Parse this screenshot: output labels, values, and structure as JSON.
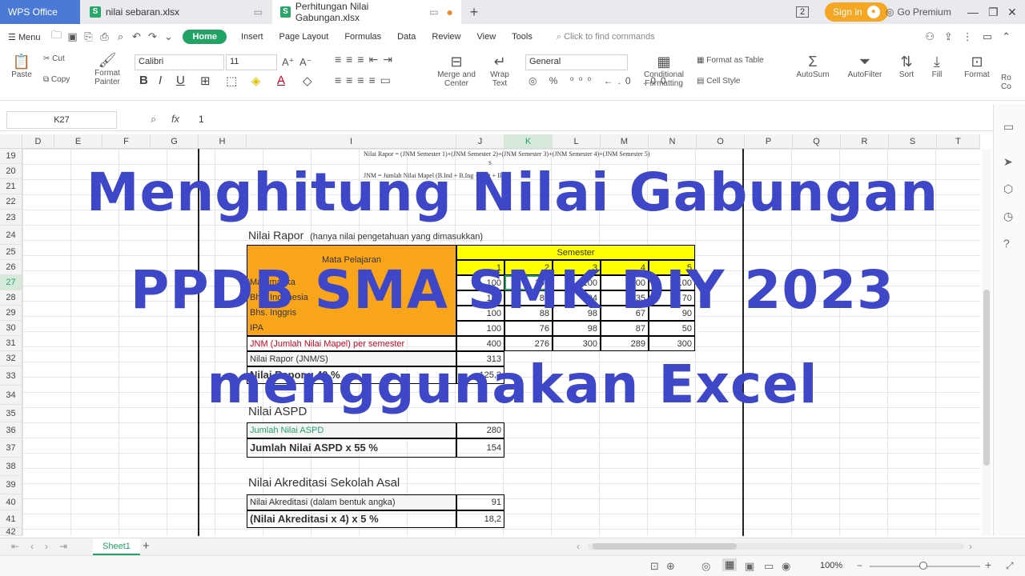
{
  "tabs": {
    "app": "WPS Office",
    "file1": "nilai sebaran.xlsx",
    "file2": "Perhitungan Nilai Gabungan.xlsx",
    "file_icon": "S"
  },
  "topbar": {
    "signin": "Sign in",
    "premium": "Go Premium",
    "badge": "2"
  },
  "menu": {
    "menu_label": "Menu",
    "items": [
      "Home",
      "Insert",
      "Page Layout",
      "Formulas",
      "Data",
      "Review",
      "View",
      "Tools"
    ],
    "search": "Click to find commands"
  },
  "ribbon": {
    "paste": "Paste",
    "cut": "Cut",
    "copy": "Copy",
    "format_painter_1": "Format",
    "format_painter_2": "Painter",
    "font_name": "Calibri",
    "font_size": "11",
    "merge_1": "Merge and",
    "merge_2": "Center",
    "wrap_1": "Wrap",
    "wrap_2": "Text",
    "number_format": "General",
    "cond_1": "Conditional",
    "cond_2": "Formatting",
    "format_table": "Format as Table",
    "cell_style": "Cell Style",
    "autosum": "AutoSum",
    "autofilter": "AutoFilter",
    "sort": "Sort",
    "fill": "Fill",
    "format": "Format",
    "rowcol": "Ro Co"
  },
  "formula_bar": {
    "cell_ref": "K27",
    "fx": "fx",
    "value": "1"
  },
  "columns": [
    "D",
    "E",
    "F",
    "G",
    "H",
    "I",
    "J",
    "K",
    "L",
    "M",
    "N",
    "O",
    "P",
    "Q",
    "R",
    "S",
    "T"
  ],
  "rows": [
    "19",
    "20",
    "21",
    "22",
    "23",
    "24",
    "25",
    "26",
    "27",
    "28",
    "29",
    "30",
    "31",
    "32",
    "33",
    "34",
    "35",
    "36",
    "37",
    "38",
    "39",
    "40",
    "41",
    "42"
  ],
  "sheet": {
    "formula_note_1": "Nilai Rapor = (JNM Semester 1)+(JNM Semester 2)+(JNM Semester 3)+(JNM Semester 4)+(JNM Semester 5)",
    "formula_note_1_den": "S",
    "formula_note_2": "JNM = Jumlah Nilai Mapel (B.Ind + B.Ing + Mat + IPA)",
    "rapor_title": "Nilai Rapor",
    "rapor_sub": "(hanya nilai pengetahuan yang dimasukkan)",
    "hdr_mapel": "Mata Pelajaran",
    "hdr_semester": "Semester",
    "sem_nums": [
      "1",
      "2",
      "3",
      "4",
      "5"
    ],
    "subjects": [
      "Matematika",
      "Bhs. Indonesia",
      "Bhs. Inggris",
      "IPA"
    ],
    "scores": [
      [
        "100",
        "100",
        "100",
        "100",
        "100"
      ],
      [
        "100",
        "88",
        "94",
        "35",
        "70"
      ],
      [
        "100",
        "88",
        "98",
        "67",
        "90"
      ],
      [
        "100",
        "76",
        "98",
        "87",
        "50"
      ]
    ],
    "jnm_label": "JNM  (Jumlah Nilai Mapel) per semester",
    "jnm_values": [
      "400",
      "276",
      "300",
      "289",
      "300"
    ],
    "rapor_label": "Nilai Rapor (JNM/S)",
    "rapor_value": "313",
    "rapor40_label": "Nilai Rapor x 40 %",
    "rapor40_value": "125,2",
    "aspd_title": "Nilai ASPD",
    "aspd_label": "Jumlah Nilai ASPD",
    "aspd_value": "280",
    "aspd55_label": "Jumlah Nilai ASPD x 55 %",
    "aspd55_value": "154",
    "akr_title": "Nilai Akreditasi Sekolah Asal",
    "akr_label": "Nilai Akreditasi (dalam bentuk angka)",
    "akr_value": "91",
    "akr5_label": "(Nilai Akreditasi x 4) x 5 %",
    "akr5_value": "18,2"
  },
  "overlay": {
    "line1": "Menghitung Nilai Gabungan",
    "line2": "PPDB SMA SMK DIY 2023",
    "line3": "menggunakan Excel"
  },
  "bottom": {
    "sheet_tab": "Sheet1",
    "zoom": "100%"
  },
  "colors": {
    "accent_green": "#21a366",
    "overlay_blue": "#3d47c7",
    "table_orange": "#f9a51b",
    "table_yellow": "#ffff00",
    "jnm_red": "#d0021b",
    "aspd_green": "#21a366"
  }
}
